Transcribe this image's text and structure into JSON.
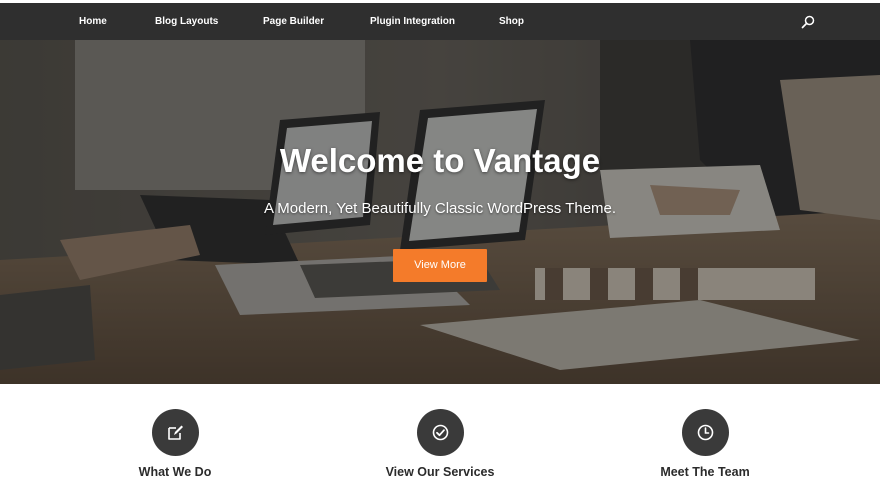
{
  "nav": {
    "items": [
      {
        "label": "Home"
      },
      {
        "label": "Blog Layouts"
      },
      {
        "label": "Page Builder"
      },
      {
        "label": "Plugin Integration"
      },
      {
        "label": "Shop"
      }
    ],
    "search_icon": "search-icon"
  },
  "hero": {
    "title": "Welcome to Vantage",
    "subtitle": "A Modern, Yet Beautifully Classic WordPress Theme.",
    "button_label": "View More",
    "button_color": "#f47b2a"
  },
  "features": [
    {
      "title": "What We Do",
      "icon": "edit-icon"
    },
    {
      "title": "View Our Services",
      "icon": "check-circle-icon"
    },
    {
      "title": "Meet The Team",
      "icon": "clock-icon"
    }
  ],
  "colors": {
    "navbar": "#2f2f2f",
    "icon_circle": "#3a3a3a",
    "accent": "#f47b2a"
  }
}
